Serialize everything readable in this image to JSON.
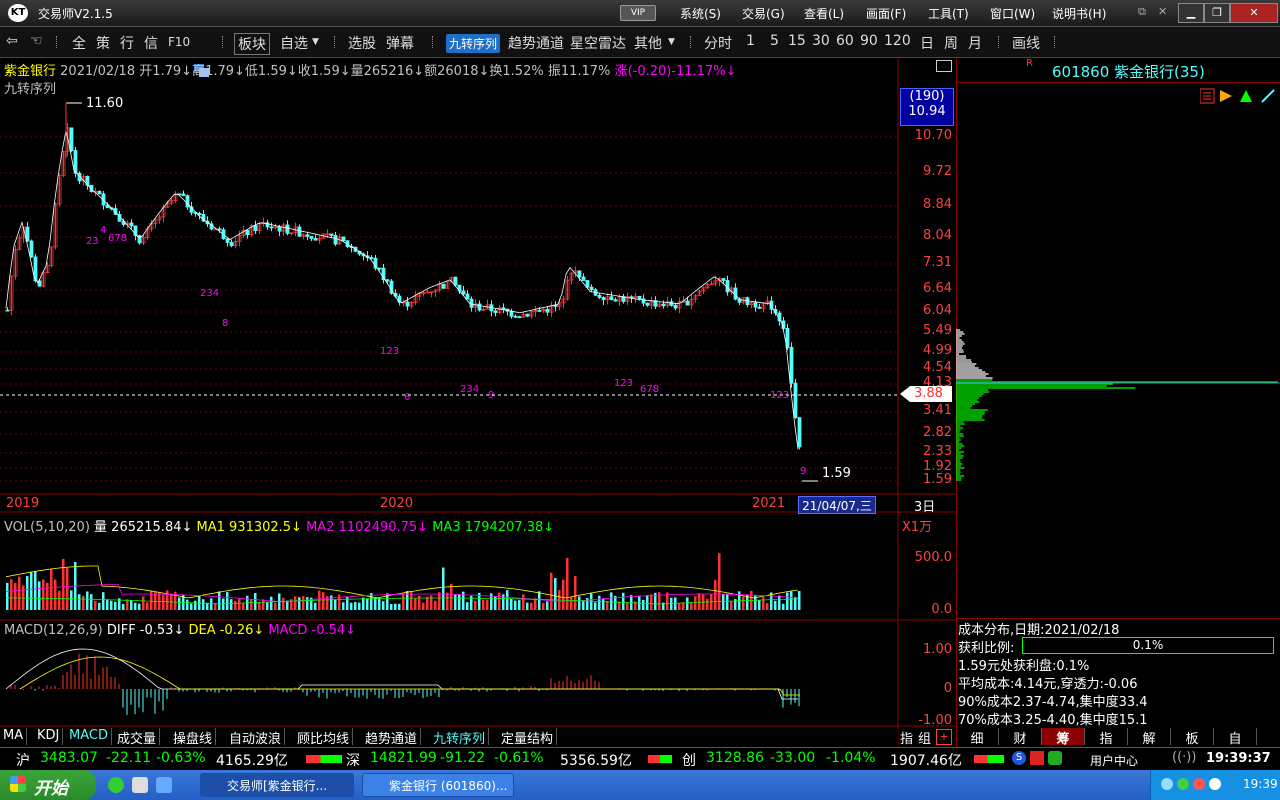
{
  "window": {
    "title": "交易师V2.1.5",
    "vip": "VIP",
    "menus": [
      "系统(S)",
      "交易(G)",
      "查看(L)",
      "画面(F)",
      "工具(T)",
      "窗口(W)",
      "说明书(H)"
    ]
  },
  "toolbar": {
    "items": [
      "全",
      "策",
      "行",
      "信",
      "F10",
      "板块",
      "自选",
      "选股",
      "弹幕",
      "九转序列",
      "趋势通道",
      "星空雷达",
      "其他",
      "分时",
      "1",
      "5",
      "15",
      "30",
      "60",
      "90",
      "120",
      "日",
      "周",
      "月",
      "画线"
    ]
  },
  "stock": {
    "name": "紫金银行",
    "code": "601860",
    "right_title": "601860 紫金银行(35)",
    "date": "2021/02/18",
    "open": "开1.79↓",
    "high": "高1.79↓",
    "low": "低1.59↓",
    "close": "收1.59↓",
    "volume": "量265216↓",
    "amount": "额26018↓",
    "turnover": "换1.52%",
    "amplitude": "振11.17%",
    "change": "涨(-0.20)-11.17%↓",
    "indicator": "九转序列"
  },
  "main_chart": {
    "high_label": "11.60",
    "low_label": "1.59",
    "current_price": "3.88",
    "top_box": [
      "(190)",
      "10.94"
    ],
    "price_axis": [
      "10.70",
      "9.72",
      "8.84",
      "8.04",
      "7.31",
      "6.64",
      "6.04",
      "5.49",
      "4.99",
      "4.54",
      "4.13",
      "3.41",
      "2.82",
      "2.33",
      "1.92",
      "1.59"
    ],
    "years": [
      "2019",
      "2020",
      "2021"
    ],
    "cursor_date": "21/04/07,三",
    "period": "3日"
  },
  "volume_panel": {
    "title": "VOL(5,10,20)",
    "vol": "量 265215.84↓",
    "ma1": "MA1 931302.5↓",
    "ma2": "MA2 1102490.75↓",
    "ma3": "MA3 1794207.38↓",
    "unit": "X1万",
    "axis": [
      "500.0",
      "0.0"
    ]
  },
  "macd_panel": {
    "title": "MACD(12,26,9)",
    "diff": "DIFF -0.53↓",
    "dea": "DEA -0.26↓",
    "macd": "MACD -0.54↓",
    "axis": [
      "1.00",
      "0",
      "-1.00"
    ]
  },
  "cost_distribution": {
    "header": "成本分布,日期:2021/02/18",
    "profit_label": "获利比例:",
    "profit_value": "0.1%",
    "line1": "1.59元处获利盘:0.1%",
    "line2": "平均成本:4.14元,穿透力:-0.06",
    "line3": "90%成本2.37-4.74,集中度33.4",
    "line4": "70%成本3.25-4.40,集中度15.1",
    "tabs": [
      "细",
      "财",
      "筹",
      "指",
      "解",
      "板",
      "自"
    ]
  },
  "bottom_tabs": [
    "MA",
    "KDJ",
    "MACD",
    "成交量",
    "操盘线",
    "自动波浪",
    "顾比均线",
    "趋势通道",
    "九转序列",
    "定量结构"
  ],
  "bottom_right": [
    "指",
    "组"
  ],
  "status": {
    "sh_label": "沪",
    "sh_value": "3483.07",
    "sh_change": "-22.11",
    "sh_pct": "-0.63%",
    "sh_amount": "4165.29亿",
    "sz_label": "深",
    "sz_value": "14821.99",
    "sz_change": "-91.22",
    "sz_pct": "-0.61%",
    "sz_amount": "5356.59亿",
    "cy_label": "创",
    "cy_value": "3128.86",
    "cy_change": "-33.00",
    "cy_pct": "-1.04%",
    "cy_amount": "1907.46亿",
    "user_center": "用户中心",
    "time": "19:39:37"
  },
  "taskbar": {
    "start": "开始",
    "items": [
      "交易师[紫金银行...",
      "紫金银行 (601860)..."
    ],
    "clock": "19:39"
  },
  "colors": {
    "up": "#ff3232",
    "down": "#54fcfc",
    "purple": "#ff00ff",
    "yellow": "#ffff00",
    "green": "#00ff00"
  }
}
